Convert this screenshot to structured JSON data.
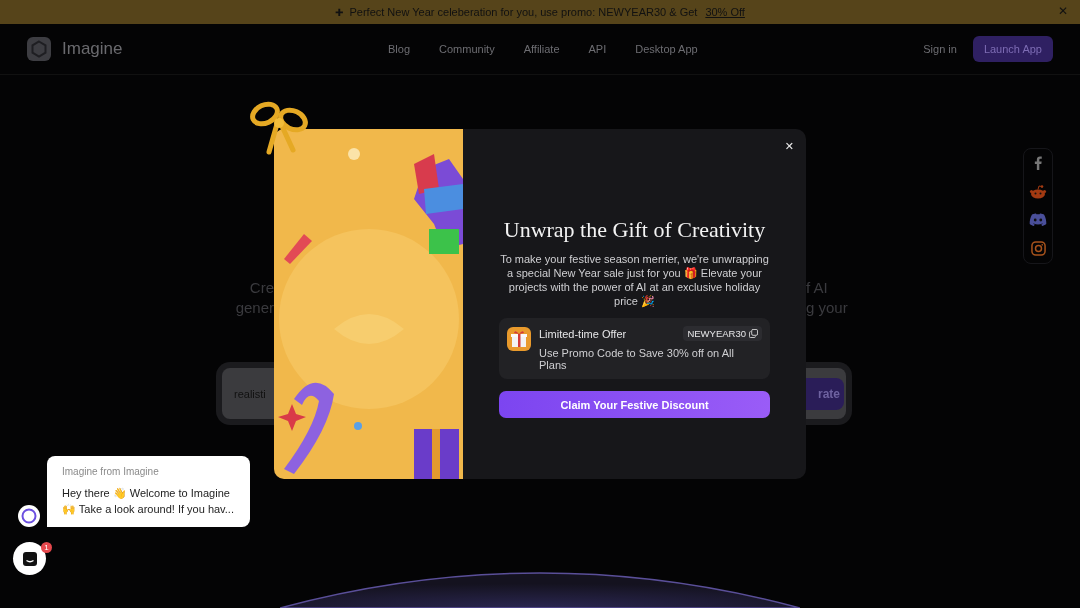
{
  "banner": {
    "icon": "✚",
    "text": "Perfect New Year celeberation for you, use promo: NEWYEAR30 & Get",
    "link": "30% Off",
    "close": "✕"
  },
  "nav": {
    "brand": "Imagine",
    "links": [
      "Blog",
      "Community",
      "Affiliate",
      "API",
      "Desktop App"
    ],
    "sign_in": "Sign in",
    "launch": "Launch App"
  },
  "hero": {
    "line_1": {
      "left": "Cre",
      "right": "f AI"
    },
    "line_2": {
      "left": "gener",
      "right": "g your"
    },
    "prompt_value": "realisti",
    "generate_button": "rate"
  },
  "modal": {
    "close": "✕",
    "title": "Unwrap the Gift of Creativity",
    "body": "To make your festive season merrier, we're unwrapping a special New Year sale just for you 🎁 Elevate your projects with the power of AI at an exclusive holiday price 🎉",
    "offer": {
      "title": "Limited-time Offer",
      "code": "NEWYEAR30",
      "detail": "Use Promo Code to Save 30% off on All Plans"
    },
    "button": "Claim Your Festive Discount"
  },
  "chat": {
    "sender": "Imagine from Imagine",
    "message_line_1": "Hey there 👋 Welcome to Imagine",
    "message_line_2": "🙌 Take a look around! If you hav...",
    "unread": "1"
  }
}
